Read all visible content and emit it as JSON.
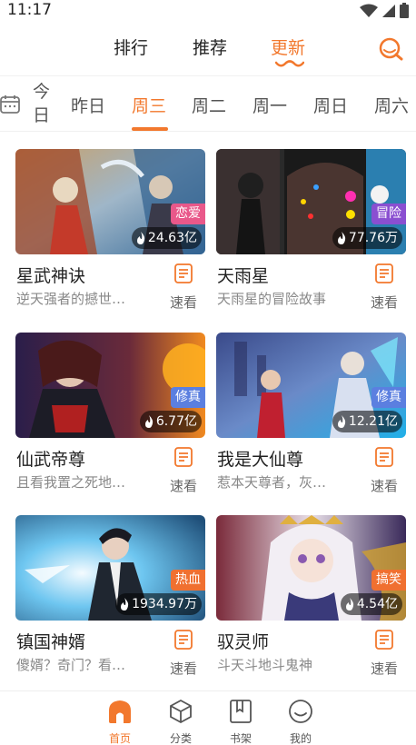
{
  "status": {
    "time": "11:17"
  },
  "top_tabs": [
    {
      "label": "排行",
      "active": false
    },
    {
      "label": "推荐",
      "active": false
    },
    {
      "label": "更新",
      "active": true
    }
  ],
  "days": [
    {
      "label": "今日"
    },
    {
      "label": "昨日"
    },
    {
      "label": "周三",
      "active": true
    },
    {
      "label": "周二"
    },
    {
      "label": "周一"
    },
    {
      "label": "周日"
    },
    {
      "label": "周六"
    }
  ],
  "comics": [
    {
      "title": "星武神诀",
      "desc": "逆天强者的撼世…",
      "tag": "恋爱",
      "tag_color": "#e9588a",
      "views": "24.63亿",
      "quick": "速看"
    },
    {
      "title": "天雨星",
      "desc": "天雨星的冒险故事",
      "tag": "冒险",
      "tag_color": "#8a4fd1",
      "views": "77.76万",
      "quick": "速看"
    },
    {
      "title": "仙武帝尊",
      "desc": "且看我置之死地…",
      "tag": "修真",
      "tag_color": "#5b7fe0",
      "views": "6.77亿",
      "quick": "速看"
    },
    {
      "title": "我是大仙尊",
      "desc": "惹本天尊者，灰…",
      "tag": "修真",
      "tag_color": "#5b7fe0",
      "views": "12.21亿",
      "quick": "速看"
    },
    {
      "title": "镇国神婿",
      "desc": "傻婿？奇门？看…",
      "tag": "热血",
      "tag_color": "#f07030",
      "views": "1934.97万",
      "quick": "速看"
    },
    {
      "title": "驭灵师",
      "desc": "斗天斗地斗鬼神",
      "tag": "搞笑",
      "tag_color": "#f07030",
      "views": "4.54亿",
      "quick": "速看"
    }
  ],
  "bottom_nav": [
    {
      "label": "首页",
      "icon": "home-icon",
      "active": true
    },
    {
      "label": "分类",
      "icon": "cube-icon"
    },
    {
      "label": "书架",
      "icon": "bookshelf-icon"
    },
    {
      "label": "我的",
      "icon": "profile-icon"
    }
  ],
  "colors": {
    "accent": "#f2782d"
  }
}
